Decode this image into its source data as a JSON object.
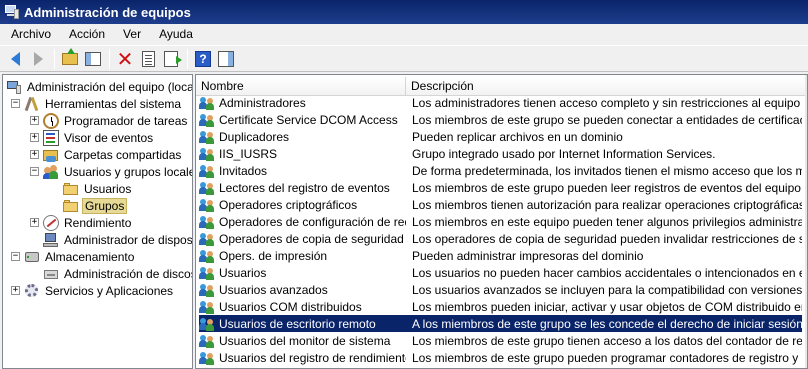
{
  "window": {
    "title": "Administración de equipos"
  },
  "menu": [
    "Archivo",
    "Acción",
    "Ver",
    "Ayuda"
  ],
  "toolbar": {
    "icons": [
      "back-arrow-icon",
      "forward-arrow-icon",
      "up-folder-icon",
      "show-hide-tree-icon",
      "delete-icon",
      "properties-icon",
      "export-list-icon",
      "help-icon",
      "action-pane-icon"
    ]
  },
  "tree": {
    "root": "Administración del equipo (local)",
    "items": [
      {
        "label": "Herramientas del sistema",
        "expander": "−"
      },
      {
        "label": "Programador de tareas",
        "expander": "+"
      },
      {
        "label": "Visor de eventos",
        "expander": "+"
      },
      {
        "label": "Carpetas compartidas",
        "expander": "+"
      },
      {
        "label": "Usuarios y grupos locales",
        "expander": "−"
      },
      {
        "label": "Usuarios",
        "expander": ""
      },
      {
        "label": "Grupos",
        "expander": ""
      },
      {
        "label": "Rendimiento",
        "expander": "+"
      },
      {
        "label": "Administrador de dispositivos",
        "expander": ""
      },
      {
        "label": "Almacenamiento",
        "expander": "−"
      },
      {
        "label": "Administración de discos",
        "expander": ""
      },
      {
        "label": "Servicios y Aplicaciones",
        "expander": "+"
      }
    ],
    "selected": "Grupos"
  },
  "list": {
    "columns": {
      "name": "Nombre",
      "description": "Descripción"
    },
    "rows": [
      {
        "name": "Administradores",
        "description": "Los administradores tienen acceso completo y sin restricciones al equipo o dominio"
      },
      {
        "name": "Certificate Service DCOM Access",
        "description": "Los miembros de este grupo se pueden conectar a entidades de certificación en la"
      },
      {
        "name": "Duplicadores",
        "description": "Pueden replicar archivos en un dominio"
      },
      {
        "name": "IIS_IUSRS",
        "description": "Grupo integrado usado por Internet Information Services."
      },
      {
        "name": "Invitados",
        "description": "De forma predeterminada, los invitados tienen el mismo acceso que los miembros"
      },
      {
        "name": "Lectores del registro de eventos",
        "description": "Los miembros de este grupo pueden leer registros de eventos del equipo local."
      },
      {
        "name": "Operadores criptográficos",
        "description": "Los miembros tienen autorización para realizar operaciones criptográficas."
      },
      {
        "name": "Operadores de configuración de red",
        "description": "Los miembros en este equipo pueden tener algunos privilegios administrativos par"
      },
      {
        "name": "Operadores de copia de seguridad",
        "description": "Los operadores de copia de seguridad pueden invalidar restricciones de segurida"
      },
      {
        "name": "Opers. de impresión",
        "description": "Pueden administrar impresoras del dominio"
      },
      {
        "name": "Usuarios",
        "description": "Los usuarios no pueden hacer cambios accidentales o intencionados en el sistema"
      },
      {
        "name": "Usuarios avanzados",
        "description": "Los usuarios avanzados se incluyen para la compatibilidad con versiones anterior"
      },
      {
        "name": "Usuarios COM distribuidos",
        "description": "Los miembros pueden iniciar, activar y usar objetos de COM distribuido en este e"
      },
      {
        "name": "Usuarios de escritorio remoto",
        "description": "A los miembros de este grupo se les concede el derecho de iniciar sesión remota"
      },
      {
        "name": "Usuarios del monitor de sistema",
        "description": "Los miembros de este grupo tienen acceso a los datos del contador de rendimiento"
      },
      {
        "name": "Usuarios del registro de rendimiento",
        "description": "Los miembros de este grupo pueden programar contadores de registro y rendimie"
      }
    ],
    "selected_index": 13
  },
  "colors": {
    "titlebar": "#0a246a",
    "selection": "#0a246a",
    "tree_selection": "#e6d996"
  }
}
